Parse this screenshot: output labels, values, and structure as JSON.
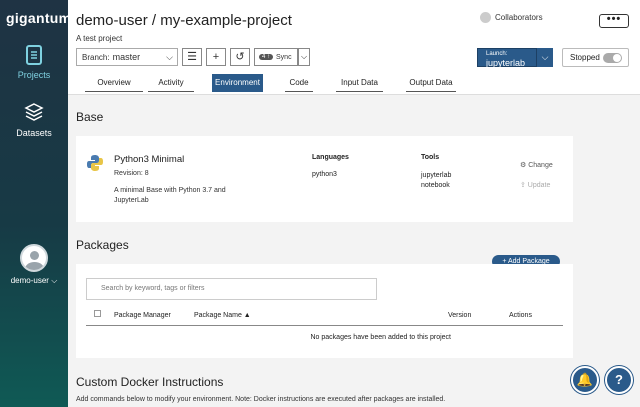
{
  "app": {
    "logo": "gigantum"
  },
  "sidebar": {
    "items": [
      {
        "label": "Projects",
        "icon": "projects-icon"
      },
      {
        "label": "Datasets",
        "icon": "datasets-icon"
      }
    ],
    "user": {
      "name": "demo-user",
      "chevron": "⌵"
    }
  },
  "header": {
    "title": "demo-user / my-example-project",
    "subtitle": "A test project",
    "collaborators": "Collaborators",
    "menu": "•••"
  },
  "toolbar": {
    "branch_prefix": "Branch:",
    "branch_name": "master",
    "sync_badge": "4 ↑",
    "sync_label": "Sync",
    "launch_small": "Launch:",
    "launch_value": "jupyterlab",
    "status": "Stopped"
  },
  "tabs": [
    {
      "label": "Overview"
    },
    {
      "label": "Activity"
    },
    {
      "label": "Environment",
      "active": true
    },
    {
      "label": "Code"
    },
    {
      "label": "Input Data"
    },
    {
      "label": "Output Data"
    }
  ],
  "base": {
    "section_title": "Base",
    "name": "Python3 Minimal",
    "revision": "Revision: 8",
    "description": "A minimal Base with Python 3.7 and JupyterLab",
    "languages_heading": "Languages",
    "languages": "python3",
    "tools_heading": "Tools",
    "tools": [
      "jupyterlab",
      "notebook"
    ],
    "change_label": "⚙ Change",
    "update_label": "⇪ Update"
  },
  "packages": {
    "section_title": "Packages",
    "add_button": "+ Add Package",
    "search_placeholder": "Search by keyword, tags or filters",
    "columns": [
      "Package Manager",
      "Package Name ▲",
      "Version",
      "Actions"
    ],
    "empty_message": "No packages have been added to this project"
  },
  "docker": {
    "section_title": "Custom Docker Instructions",
    "description": "Add commands below to modify your environment. Note: Docker instructions are executed after packages are installed."
  },
  "fabs": {
    "notifications": "🔔",
    "help": "?"
  },
  "colors": {
    "accent": "#2a5a8a",
    "sidebar_top": "#1f3344",
    "sidebar_bottom": "#0f5a55"
  }
}
